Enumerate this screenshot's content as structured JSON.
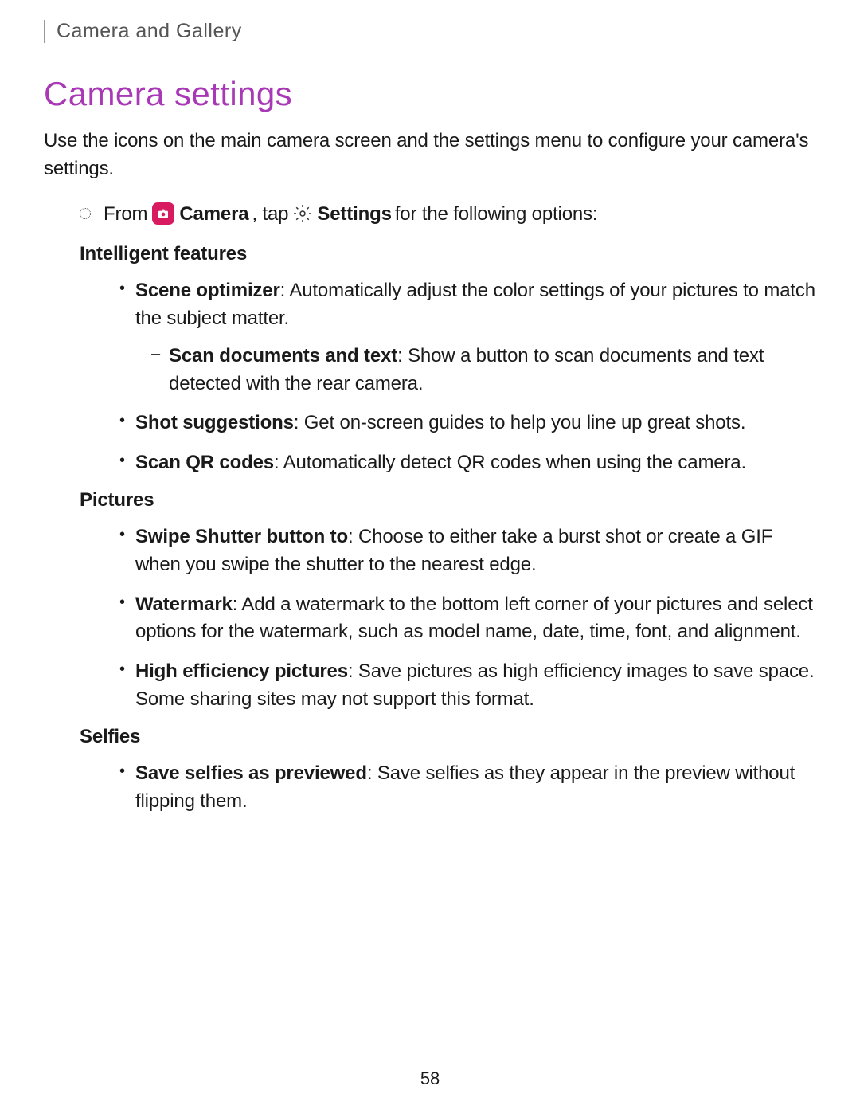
{
  "breadcrumb": "Camera and Gallery",
  "heading": "Camera settings",
  "intro": "Use the icons on the main camera screen and the settings menu to configure your camera's settings.",
  "instruction": {
    "from": "From",
    "camera_label": "Camera",
    "tap": ", tap",
    "settings_label": "Settings",
    "rest": "for the following options:"
  },
  "sections": {
    "intelligent": {
      "title": "Intelligent features",
      "items": [
        {
          "bold": "Scene optimizer",
          "text": ": Automatically adjust the color settings of your pictures to match the subject matter.",
          "sub": {
            "bold": "Scan documents and text",
            "text": ": Show a button to scan documents and text detected with the rear camera."
          }
        },
        {
          "bold": "Shot suggestions",
          "text": ": Get on-screen guides to help you line up great shots."
        },
        {
          "bold": "Scan QR codes",
          "text": ": Automatically detect QR codes when using the camera."
        }
      ]
    },
    "pictures": {
      "title": "Pictures",
      "items": [
        {
          "bold": "Swipe Shutter button to",
          "text": ": Choose to either take a burst shot or create a GIF when you swipe the shutter to the nearest edge."
        },
        {
          "bold": "Watermark",
          "text": ": Add a watermark to the bottom left corner of your pictures and select options for the watermark, such as model name, date, time, font, and alignment."
        },
        {
          "bold": "High efficiency pictures",
          "text": ": Save pictures as high efficiency images to save space. Some sharing sites may not support this format."
        }
      ]
    },
    "selfies": {
      "title": "Selfies",
      "items": [
        {
          "bold": "Save selfies as previewed",
          "text": ": Save selfies as they appear in the preview without flipping them."
        }
      ]
    }
  },
  "page_number": "58"
}
